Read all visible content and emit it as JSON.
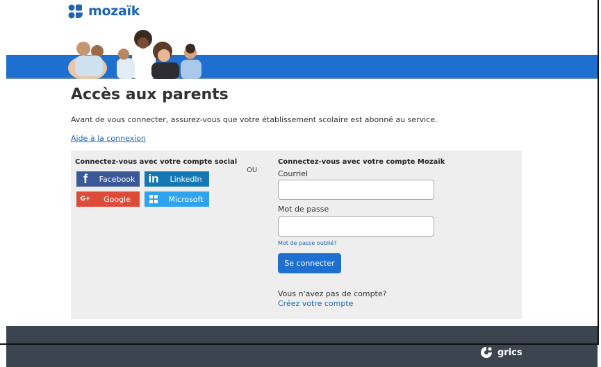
{
  "brand": {
    "name": "mozaïk",
    "color": "#1e64b4"
  },
  "banner": {
    "bar_color": "#1e6fcf"
  },
  "page": {
    "title": "Accès aux parents",
    "intro": "Avant de vous connecter, assurez-vous que votre établissement scolaire est abonné au service.",
    "help_link": "Aide à la connexion"
  },
  "social": {
    "title": "Connectez-vous avec votre compte social",
    "buttons": [
      {
        "label": "Facebook",
        "icon": "facebook-icon",
        "color": "#3b5998"
      },
      {
        "label": "LinkedIn",
        "icon": "linkedin-icon",
        "color": "#1577b4"
      },
      {
        "label": "Google",
        "icon": "google-plus-icon",
        "color": "#dd4b39"
      },
      {
        "label": "Microsoft",
        "icon": "microsoft-icon",
        "color": "#2ea4ef"
      }
    ]
  },
  "separator": "OU",
  "mozaik_login": {
    "title": "Connectez-vous avec votre compte Mozaïk",
    "email_label": "Courriel",
    "email_value": "",
    "password_label": "Mot de passe",
    "password_value": "",
    "forgot_link": "Mot de passe oublié?",
    "submit_label": "Se connecter",
    "no_account": "Vous n'avez pas de compte?",
    "create_link": "Créez votre compte"
  },
  "footer": {
    "brand": "grics",
    "color": "#3c454f"
  }
}
